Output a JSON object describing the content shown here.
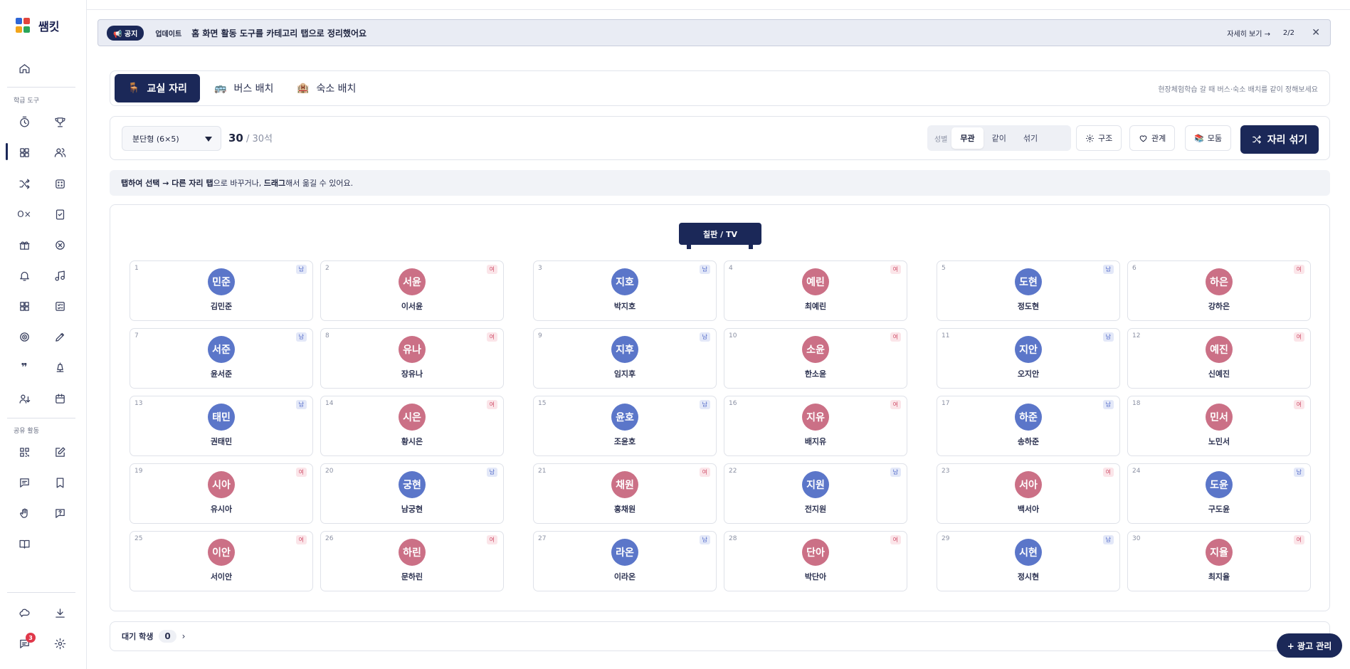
{
  "app": {
    "name": "쌤킷"
  },
  "colors": {
    "navy": "#1b2858",
    "male": "#5b76c9",
    "female": "#cb7086"
  },
  "sidebar": {
    "section_tools": "학급 도구",
    "section_shared": "공유 활동",
    "notification_count": "3",
    "icons": [
      "home-icon",
      "timer-icon",
      "trophy-icon",
      "grid-icon",
      "people-icon",
      "shuffle-icon",
      "dice-icon",
      "ox-icon",
      "checklist-icon",
      "gift-icon",
      "x-circle-icon",
      "bell-icon",
      "music-icon",
      "blocks-icon",
      "checkbox-list-icon",
      "target-icon",
      "pencil-icon",
      "quote-icon",
      "lamp-icon",
      "user-sort-icon",
      "calendar-icon",
      "qr-icon",
      "edit-icon",
      "message-icon",
      "bookmark-icon",
      "hand-icon",
      "question-bubble-icon",
      "book-icon",
      "cloud-chat-icon",
      "download-icon",
      "chat-icon",
      "settings-icon"
    ]
  },
  "notice": {
    "pill": "📢 공지",
    "tag": "업데이트",
    "text": "홈 화면 활동 도구를 카테고리 탭으로 정리했어요",
    "more": "자세히 보기 →",
    "page": "2/2",
    "close": "✕"
  },
  "tabs": [
    {
      "label": "교실 자리",
      "icon": "chair-icon",
      "glyph": "🪑"
    },
    {
      "label": "버스 배치",
      "icon": "bus-icon",
      "glyph": "🚌"
    },
    {
      "label": "숙소 배치",
      "icon": "building-icon",
      "glyph": "🏨"
    }
  ],
  "tab_hint": "현장체험학습 갈 때 버스·숙소 배치를 같이 정해보세요",
  "controls": {
    "layout_select": "분단형 (6×5)",
    "seat_count": "30",
    "seat_total": " / 30석",
    "gender_label": "성별",
    "gender_options": [
      "무관",
      "같이",
      "섞기"
    ],
    "structure_btn": "구조",
    "relation_btn": "관계",
    "group_btn": "모둠",
    "shuffle_btn": "자리 섞기"
  },
  "instruction": {
    "part1": "탭하여 선택 → 다른 자리 탭",
    "part2": "으로 바꾸거나, ",
    "part3": "드래그",
    "part4": "해서 옮길 수 있어요."
  },
  "board_label": "칠판 / TV",
  "seats": [
    {
      "no": "1",
      "avatar": "민준",
      "name": "김민준",
      "g": "m",
      "gl": "남"
    },
    {
      "no": "2",
      "avatar": "서윤",
      "name": "이서윤",
      "g": "f",
      "gl": "여"
    },
    {
      "no": "3",
      "avatar": "지호",
      "name": "박지호",
      "g": "m",
      "gl": "남"
    },
    {
      "no": "4",
      "avatar": "예린",
      "name": "최예린",
      "g": "f",
      "gl": "여"
    },
    {
      "no": "5",
      "avatar": "도현",
      "name": "정도현",
      "g": "m",
      "gl": "남"
    },
    {
      "no": "6",
      "avatar": "하은",
      "name": "강하은",
      "g": "f",
      "gl": "여"
    },
    {
      "no": "7",
      "avatar": "서준",
      "name": "윤서준",
      "g": "m",
      "gl": "남"
    },
    {
      "no": "8",
      "avatar": "유나",
      "name": "장유나",
      "g": "f",
      "gl": "여"
    },
    {
      "no": "9",
      "avatar": "지후",
      "name": "임지후",
      "g": "m",
      "gl": "남"
    },
    {
      "no": "10",
      "avatar": "소윤",
      "name": "한소윤",
      "g": "f",
      "gl": "여"
    },
    {
      "no": "11",
      "avatar": "지안",
      "name": "오지안",
      "g": "m",
      "gl": "남"
    },
    {
      "no": "12",
      "avatar": "예진",
      "name": "신예진",
      "g": "f",
      "gl": "여"
    },
    {
      "no": "13",
      "avatar": "태민",
      "name": "권태민",
      "g": "m",
      "gl": "남"
    },
    {
      "no": "14",
      "avatar": "시은",
      "name": "황시은",
      "g": "f",
      "gl": "여"
    },
    {
      "no": "15",
      "avatar": "윤호",
      "name": "조윤호",
      "g": "m",
      "gl": "남"
    },
    {
      "no": "16",
      "avatar": "지유",
      "name": "배지유",
      "g": "f",
      "gl": "여"
    },
    {
      "no": "17",
      "avatar": "하준",
      "name": "송하준",
      "g": "m",
      "gl": "남"
    },
    {
      "no": "18",
      "avatar": "민서",
      "name": "노민서",
      "g": "f",
      "gl": "여"
    },
    {
      "no": "19",
      "avatar": "시아",
      "name": "유시아",
      "g": "f",
      "gl": "여"
    },
    {
      "no": "20",
      "avatar": "궁현",
      "name": "남궁현",
      "g": "m",
      "gl": "남"
    },
    {
      "no": "21",
      "avatar": "채원",
      "name": "홍채원",
      "g": "f",
      "gl": "여"
    },
    {
      "no": "22",
      "avatar": "지원",
      "name": "전지원",
      "g": "m",
      "gl": "남"
    },
    {
      "no": "23",
      "avatar": "서아",
      "name": "백서아",
      "g": "f",
      "gl": "여"
    },
    {
      "no": "24",
      "avatar": "도윤",
      "name": "구도윤",
      "g": "m",
      "gl": "남"
    },
    {
      "no": "25",
      "avatar": "이안",
      "name": "서이안",
      "g": "f",
      "gl": "여"
    },
    {
      "no": "26",
      "avatar": "하린",
      "name": "문하린",
      "g": "f",
      "gl": "여"
    },
    {
      "no": "27",
      "avatar": "라온",
      "name": "이라온",
      "g": "m",
      "gl": "남"
    },
    {
      "no": "28",
      "avatar": "단아",
      "name": "박단아",
      "g": "f",
      "gl": "여"
    },
    {
      "no": "29",
      "avatar": "시현",
      "name": "정시현",
      "g": "m",
      "gl": "남"
    },
    {
      "no": "30",
      "avatar": "지율",
      "name": "최지율",
      "g": "f",
      "gl": "여"
    }
  ],
  "waiting": {
    "label": "대기 학생",
    "count": "0",
    "arrow": "›"
  },
  "ad_button": "+ 광고 관리"
}
